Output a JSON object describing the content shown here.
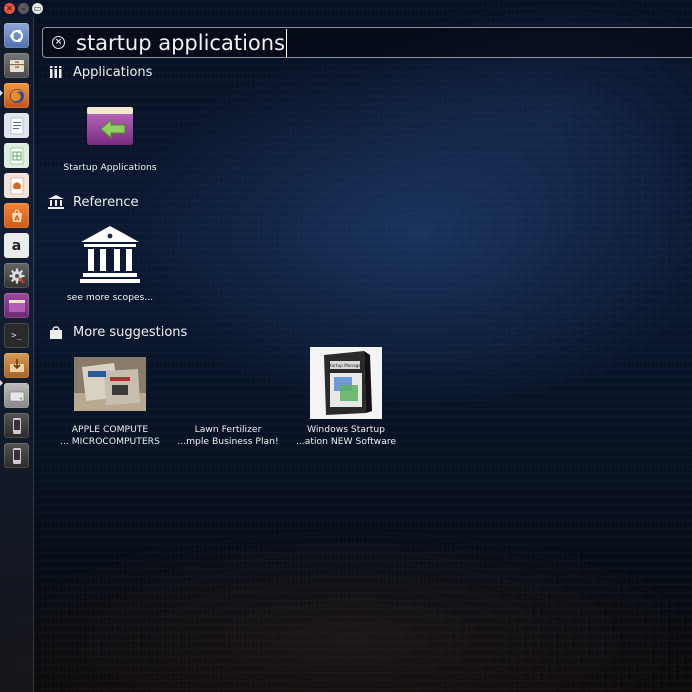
{
  "window_controls": {
    "close_glyph": "✕",
    "minimize_glyph": "–",
    "maximize_glyph": "▭"
  },
  "launcher": {
    "items": [
      {
        "name": "dash-home",
        "icon": "ubuntu-logo-icon"
      },
      {
        "name": "files",
        "icon": "file-cabinet-icon"
      },
      {
        "name": "firefox",
        "icon": "firefox-icon"
      },
      {
        "name": "libreoffice-writer",
        "icon": "writer-icon"
      },
      {
        "name": "libreoffice-calc",
        "icon": "calc-icon"
      },
      {
        "name": "libreoffice-impress",
        "icon": "impress-icon"
      },
      {
        "name": "software-center",
        "icon": "software-center-icon"
      },
      {
        "name": "amazon",
        "icon": "amazon-icon"
      },
      {
        "name": "system-settings",
        "icon": "settings-gear-icon"
      },
      {
        "name": "startup-applications",
        "icon": "startup-apps-icon"
      },
      {
        "name": "terminal",
        "icon": "terminal-icon"
      },
      {
        "name": "app-installer",
        "icon": "installer-icon"
      },
      {
        "name": "drive",
        "icon": "drive-icon"
      },
      {
        "name": "device-1",
        "icon": "phone-icon"
      },
      {
        "name": "device-2",
        "icon": "phone-icon"
      }
    ],
    "terminal_glyph": ">_",
    "amazon_glyph": "a"
  },
  "search": {
    "query": "startup applications",
    "clear_glyph": "×"
  },
  "sections": {
    "applications": {
      "title": "Applications",
      "results": [
        {
          "label": "Startup Applications"
        }
      ]
    },
    "reference": {
      "title": "Reference",
      "results": [
        {
          "label": "see more scopes..."
        }
      ]
    },
    "more_suggestions": {
      "title": "More suggestions",
      "results": [
        {
          "line1": "APPLE COMPUTE",
          "line2": "... MICROCOMPUTERS"
        },
        {
          "line1": "Lawn Fertilizer",
          "line2": "...mple Business Plan!"
        },
        {
          "line1": "Windows Startup",
          "line2": "...ation NEW Software",
          "box_text": "Startup Manager"
        }
      ]
    }
  },
  "colors": {
    "accent_orange": "#e0573a",
    "text": "#f0f0f0"
  }
}
